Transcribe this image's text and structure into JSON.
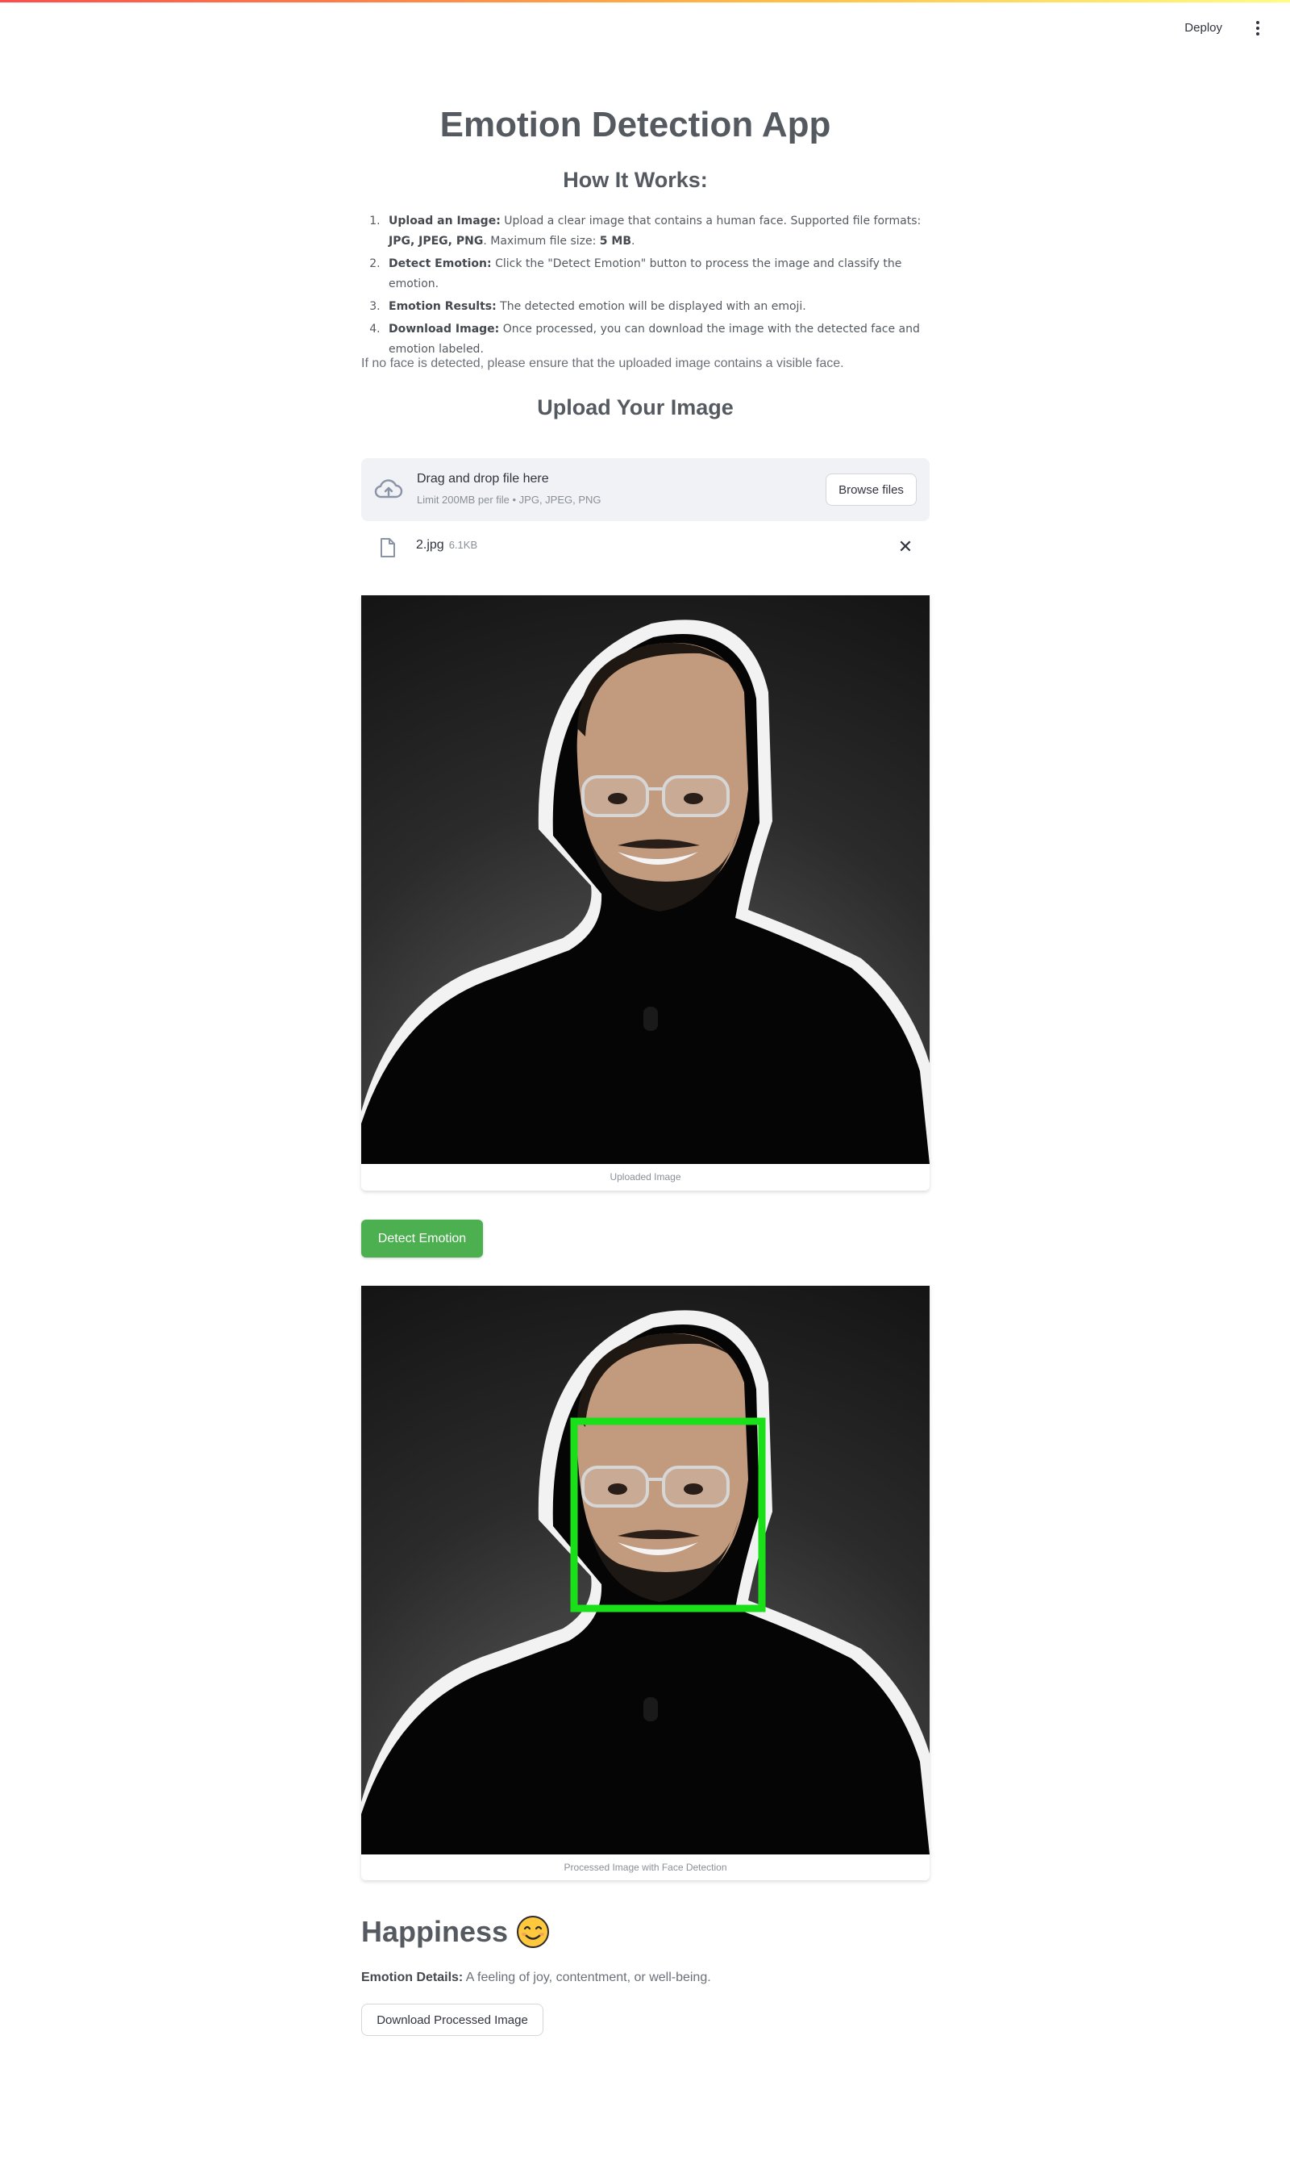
{
  "header": {
    "deploy_label": "Deploy",
    "menu_icon": "kebab-menu-icon"
  },
  "app": {
    "title": "Emotion Detection App"
  },
  "how_it_works": {
    "heading": "How It Works:",
    "steps": [
      {
        "label": "Upload an Image:",
        "text": " Upload a clear image that contains a human face. Supported file formats: ",
        "formats": "JPG, JPEG, PNG",
        "text2": ". Maximum file size: ",
        "size": "5 MB",
        "text3": "."
      },
      {
        "label": "Detect Emotion:",
        "text": " Click the \"Detect Emotion\" button to process the image and classify the emotion."
      },
      {
        "label": "Emotion Results:",
        "text": " The detected emotion will be displayed with an emoji."
      },
      {
        "label": "Download Image:",
        "text": " Once processed, you can download the image with the detected face and emotion labeled."
      }
    ],
    "note": "If no face is detected, please ensure that the uploaded image contains a visible face."
  },
  "upload": {
    "heading": "Upload Your Image",
    "dropzone_text": "Drag and drop file here",
    "limit_text": "Limit 200MB per file • JPG, JPEG, PNG",
    "browse_label": "Browse files",
    "file": {
      "name": "2.jpg",
      "size": "6.1KB"
    },
    "remove_symbol": "✕"
  },
  "uploaded_image": {
    "caption": "Uploaded Image"
  },
  "detect_button_label": "Detect Emotion",
  "processed_image": {
    "caption": "Processed Image with Face Detection",
    "box_color": "#19e019"
  },
  "result": {
    "emotion": "Happiness",
    "emoji_icon": "smiling-face-icon",
    "details_label": "Emotion Details:",
    "details_text": "A feeling of joy, contentment, or well-being.",
    "download_label": "Download Processed Image"
  },
  "colors": {
    "primary_button": "#4caf50",
    "text": "#555a61",
    "dropzone_bg": "#f0f2f6"
  }
}
